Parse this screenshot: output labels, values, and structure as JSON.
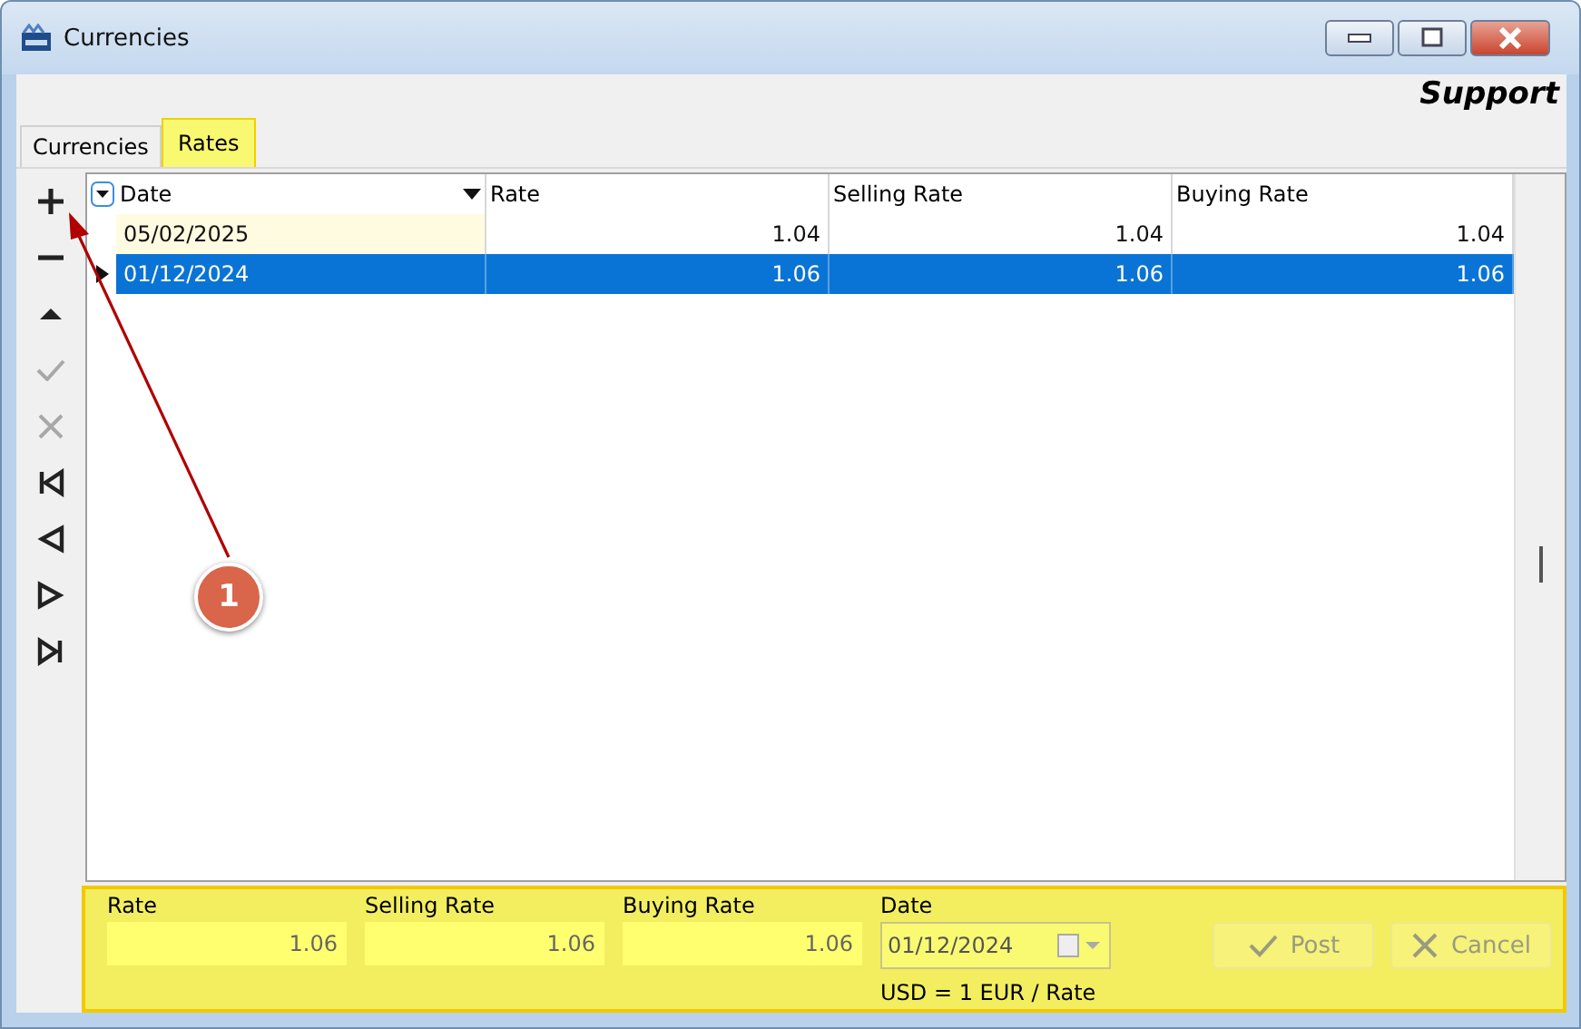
{
  "window": {
    "title": "Currencies"
  },
  "brand": "Support",
  "tabs": [
    {
      "label": "Currencies",
      "selected": false,
      "highlighted": false
    },
    {
      "label": "Rates",
      "selected": true,
      "highlighted": true
    }
  ],
  "toolbar": [
    {
      "kind": "add",
      "disabled": false
    },
    {
      "kind": "remove",
      "disabled": false
    },
    {
      "kind": "up",
      "disabled": false
    },
    {
      "kind": "confirm",
      "disabled": true
    },
    {
      "kind": "cancel",
      "disabled": true
    },
    {
      "kind": "first",
      "disabled": false
    },
    {
      "kind": "prior",
      "disabled": false
    },
    {
      "kind": "next",
      "disabled": false
    },
    {
      "kind": "last",
      "disabled": false
    }
  ],
  "table": {
    "columns": [
      "Date",
      "Rate",
      "Selling Rate",
      "Buying Rate"
    ],
    "rows": [
      {
        "cells": [
          "05/02/2025",
          "1.04",
          "1.04",
          "1.04"
        ],
        "selected": false
      },
      {
        "cells": [
          "01/12/2024",
          "1.06",
          "1.06",
          "1.06"
        ],
        "selected": true
      }
    ]
  },
  "editor": {
    "fields": [
      {
        "label": "Rate",
        "value": "1.06"
      },
      {
        "label": "Selling Rate",
        "value": "1.06"
      },
      {
        "label": "Buying Rate",
        "value": "1.06"
      }
    ],
    "date": {
      "label": "Date",
      "value": "01/12/2024"
    },
    "note": "USD = 1 EUR / Rate",
    "buttons": [
      {
        "kind": "post",
        "label": "Post",
        "disabled": true
      },
      {
        "kind": "cancel",
        "label": "Cancel",
        "disabled": true
      }
    ]
  },
  "annotation": {
    "label": "1"
  }
}
